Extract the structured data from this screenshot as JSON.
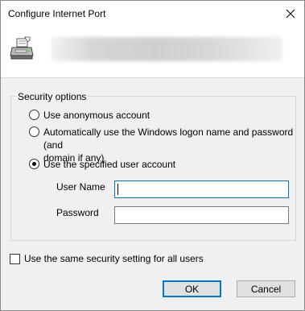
{
  "window": {
    "title": "Configure Internet Port",
    "close_icon": "close-icon"
  },
  "header": {
    "icon": "printer-icon"
  },
  "security": {
    "group_label": "Security options",
    "options": [
      {
        "label": "Use anonymous account",
        "checked": false
      },
      {
        "label": "Automatically use the Windows logon name and password (and",
        "label_line2": "domain if any)",
        "checked": false
      },
      {
        "label": "Use the specified user account",
        "checked": true
      }
    ],
    "username": {
      "label": "User Name",
      "value": ""
    },
    "password": {
      "label": "Password",
      "value": ""
    }
  },
  "apply_all": {
    "label": "Use the same security setting for all users",
    "checked": false
  },
  "buttons": {
    "ok": "OK",
    "cancel": "Cancel"
  },
  "colors": {
    "focus_accent": "#0078d7",
    "dialog_bg": "#f0f0f0",
    "header_bg": "#ffffff"
  }
}
